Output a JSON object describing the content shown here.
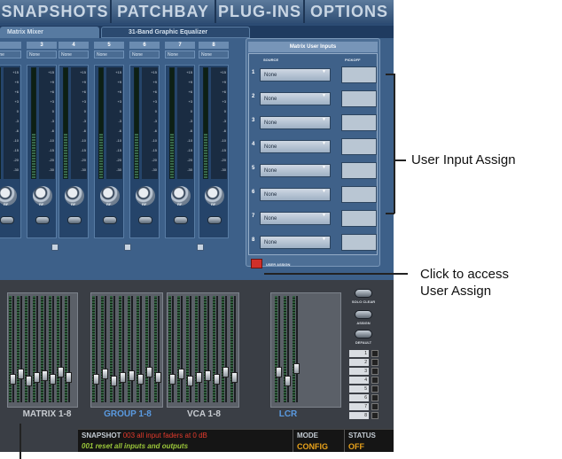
{
  "nav": {
    "tabs": [
      "SNAPSHOTS",
      "PATCHBAY",
      "PLUG-INS",
      "OPTIONS"
    ]
  },
  "subtabs": [
    "Matrix Mixer",
    "31-Band Graphic Equalizer"
  ],
  "matrix": {
    "channel_numbers": [
      "",
      "3",
      "4",
      "5",
      "6",
      "7",
      "8"
    ],
    "channel_source": "None",
    "meter_scale": [
      "+15",
      "+9",
      "+6",
      "+3",
      "0",
      "-3",
      "-6",
      "-10",
      "-15",
      "-20",
      "-30"
    ],
    "knob_label": "RF"
  },
  "user_inputs": {
    "title": "Matrix User Inputs",
    "col_source": "SOURCE",
    "col_pickoff": "PICKOFF",
    "rows": [
      {
        "num": "1",
        "source": "None"
      },
      {
        "num": "2",
        "source": "None"
      },
      {
        "num": "3",
        "source": "None"
      },
      {
        "num": "4",
        "source": "None"
      },
      {
        "num": "5",
        "source": "None"
      },
      {
        "num": "6",
        "source": "None"
      },
      {
        "num": "7",
        "source": "None"
      },
      {
        "num": "8",
        "source": "None"
      }
    ],
    "assign_label": "USER ASSIGN"
  },
  "surface": {
    "groups": [
      "MATRIX 1-8",
      "GROUP 1-8",
      "VCA 1-8",
      "LCR"
    ],
    "side_buttons": [
      "SOLO CLEAR",
      "ASSIGN",
      "DEFAULT"
    ],
    "banks": [
      "1",
      "2",
      "3",
      "4",
      "5",
      "6",
      "7",
      "8"
    ]
  },
  "status": {
    "snapshot_label": "SNAPSHOT",
    "snapshot_current": "003 all input faders at 0 dB",
    "snapshot_next": "001 reset all inputs and outputs",
    "mode_label": "MODE",
    "mode_value": "CONFIG",
    "status_label": "STATUS",
    "status_value": "OFF"
  },
  "callouts": {
    "user_input_assign": "User Input Assign",
    "click_line1": "Click to access",
    "click_line2": "User Assign"
  },
  "colors": {
    "snapshot_current": "#e23a2c",
    "snapshot_next": "#9cc83a",
    "mode_status": "#e9a21a",
    "group_label_highlight": "#5a9ae0"
  }
}
